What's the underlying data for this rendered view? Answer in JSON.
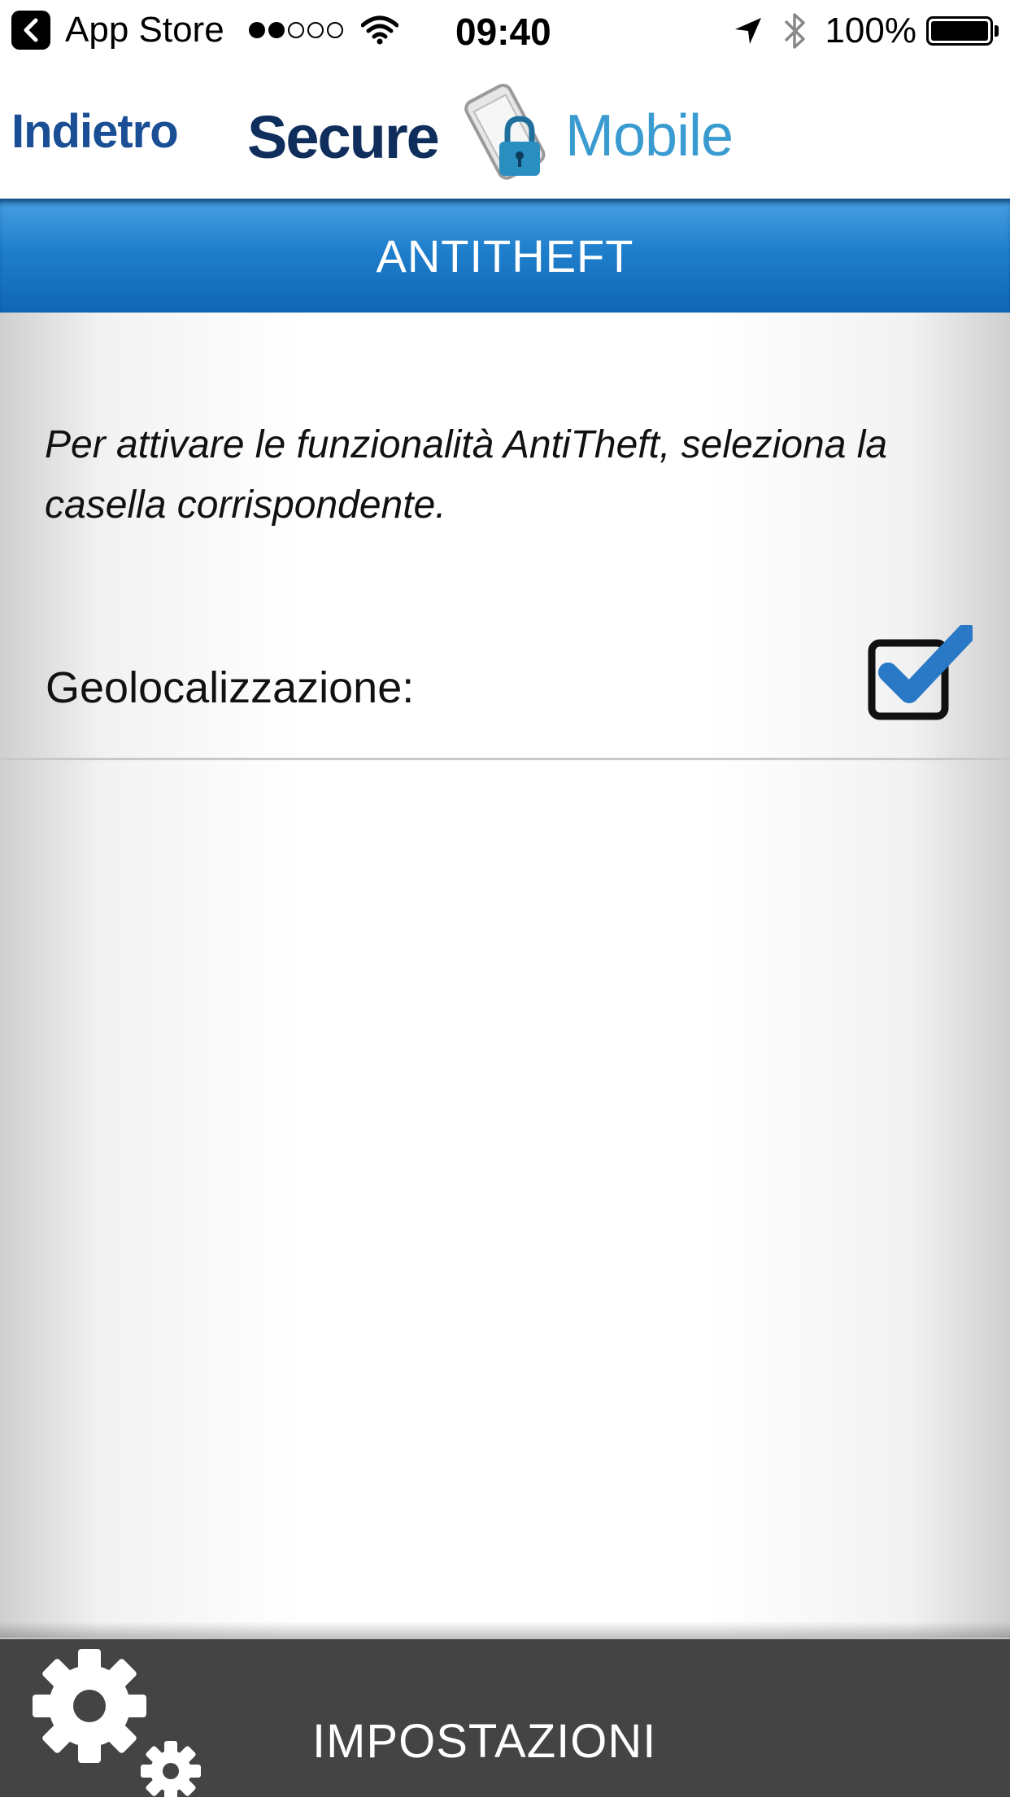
{
  "status_bar": {
    "back_app": "App Store",
    "time": "09:40",
    "battery": "100%"
  },
  "header": {
    "back_label": "Indietro",
    "logo_word1": "Secure",
    "logo_word2": "Mobile"
  },
  "title_bar": {
    "title": "ANTITHEFT"
  },
  "content": {
    "instructions": "Per attivare le funzionalità AntiTheft, seleziona la casella corrispondente.",
    "geolocation_label": "Geolocalizzazione:",
    "geolocation_checked": true
  },
  "bottom_bar": {
    "label": "IMPOSTAZIONI",
    "icon": "gears-icon"
  },
  "colors": {
    "title_bar": "#1f7fcc",
    "back_link": "#1a4f95",
    "checkmark": "#2a79c7",
    "bottom_bar": "#444444"
  }
}
